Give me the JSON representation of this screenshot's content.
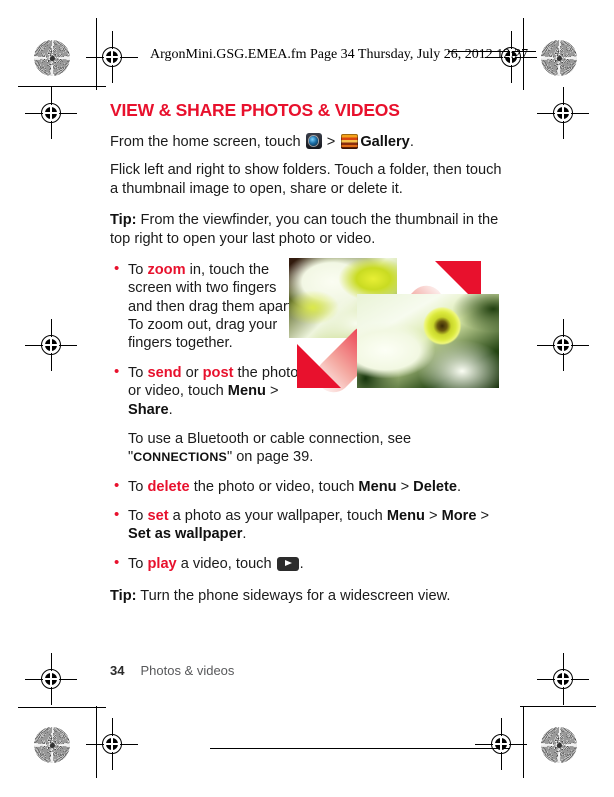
{
  "header_stamp": "ArgonMini.GSG.EMEA.fm  Page 34  Thursday, July 26, 2012  12:27",
  "section": {
    "title": "VIEW & SHARE PHOTOS & VIDEOS",
    "intro_pre": "From the home screen, touch ",
    "intro_sep": " > ",
    "intro_app": "Gallery",
    "intro_end": ".",
    "paragraph": "Flick left and right to show folders. Touch a folder, then touch a thumbnail image to open, share or delete it.",
    "tip1_label": "Tip:",
    "tip1_text": " From the viewfinder, you can touch the thumbnail in the top right to open your last photo or video.",
    "tip2_label": "Tip:",
    "tip2_text": " Turn the phone sideways for a widescreen view."
  },
  "bullets": [
    {
      "pre": "To ",
      "keyword": "zoom",
      "post": " in, touch the screen with two fingers and then drag them apart. To zoom out, drag your fingers together."
    },
    {
      "pre": "To ",
      "keyword": "send",
      "mid": " or ",
      "keyword2": "post",
      "post": " the photo or video, touch ",
      "menu": "Menu",
      "sep": " > ",
      "action": "Share",
      "end": "."
    },
    {
      "pre": "To ",
      "keyword": "delete",
      "post": " the photo or video, touch ",
      "menu": "Menu",
      "sep": " > ",
      "action": "Delete",
      "end": "."
    },
    {
      "pre": "To ",
      "keyword": "set",
      "post": " a photo as your wallpaper, touch ",
      "menu": "Menu",
      "sep": " > ",
      "action": "More",
      "sep2": " > ",
      "action2": "Set as wallpaper",
      "end": "."
    },
    {
      "pre": "To ",
      "keyword": "play",
      "post": " a video, touch ",
      "end": "."
    }
  ],
  "crossref": {
    "lead": "To use a Bluetooth or cable connection, see",
    "quote_open": "\"",
    "target": "CONNECTIONS",
    "quote_close": "\"",
    "tail": " on page 39."
  },
  "icons": {
    "camera": "camera-icon",
    "gallery": "gallery-icon",
    "play": "play-icon"
  },
  "figure": {
    "photo_a_alt": "daffodil-thumbnail",
    "photo_b_alt": "daffodil-zoomed",
    "gesture_alt": "pinch-zoom-gesture-arrows"
  },
  "footer": {
    "page_number": "34",
    "chapter": "Photos & videos"
  },
  "colors": {
    "accent_red": "#e8112d",
    "body_text": "#1b1b1b",
    "footer_text": "#58595b"
  }
}
